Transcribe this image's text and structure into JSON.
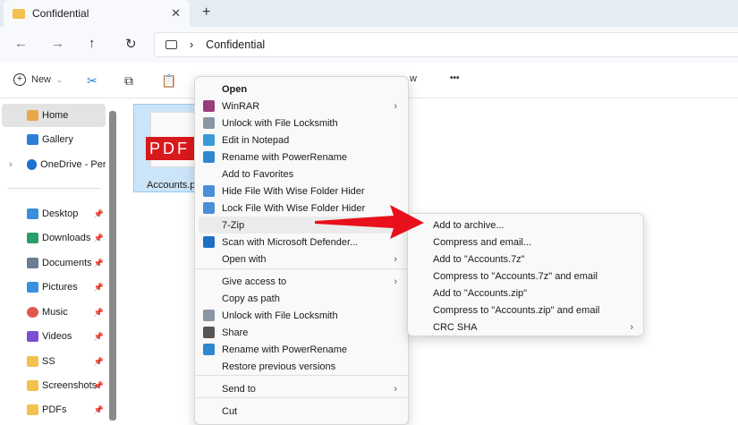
{
  "window": {
    "tab_title": "Confidential",
    "close": "✕",
    "new_tab": "+"
  },
  "address": {
    "path": "Confidential",
    "sep": "›",
    "back": "←",
    "forward": "→",
    "up": "↑",
    "refresh": "↻"
  },
  "toolbar": {
    "new_label": "New",
    "view_partial": "w",
    "more": "•••"
  },
  "sidebar": {
    "items": [
      {
        "label": "Home",
        "color": "#e8a64a"
      },
      {
        "label": "Gallery",
        "color": "#2b7fd6"
      },
      {
        "label": "OneDrive - Perso",
        "color": "#1a73d1"
      },
      {
        "label": "Desktop",
        "color": "#3b8fd8"
      },
      {
        "label": "Downloads",
        "color": "#2a9d6a"
      },
      {
        "label": "Documents",
        "color": "#6b7c93"
      },
      {
        "label": "Pictures",
        "color": "#3a8fe0"
      },
      {
        "label": "Music",
        "color": "#e2574c"
      },
      {
        "label": "Videos",
        "color": "#7a4fd6"
      },
      {
        "label": "SS",
        "color": "#f2c14e"
      },
      {
        "label": "Screenshots",
        "color": "#f2c14e"
      },
      {
        "label": "PDFs",
        "color": "#f2c14e"
      }
    ]
  },
  "file": {
    "name": "Accounts.pdf",
    "name_visible": "Accounts.p",
    "badge": "PDF"
  },
  "context_menu": {
    "items": [
      {
        "label": "Open",
        "bold": true
      },
      {
        "label": "WinRAR",
        "sub": true,
        "icon": "#9b3b7a"
      },
      {
        "label": "Unlock with File Locksmith",
        "icon": "#8a96a3"
      },
      {
        "label": "Edit in Notepad",
        "icon": "#3a9ad9"
      },
      {
        "label": "Rename with PowerRename",
        "icon": "#2f86d1"
      },
      {
        "label": "Add to Favorites"
      },
      {
        "label": "Hide File With Wise Folder Hider",
        "icon": "#4a8fd6"
      },
      {
        "label": "Lock File With Wise Folder Hider",
        "icon": "#4a8fd6"
      },
      {
        "label": "7-Zip",
        "highlight": true
      },
      {
        "label": "Scan with Microsoft Defender...",
        "icon": "#1f6fc4"
      },
      {
        "label": "Open with",
        "sub": true
      },
      {
        "label": "Give access to",
        "sub": true
      },
      {
        "label": "Copy as path"
      },
      {
        "label": "Unlock with File Locksmith",
        "icon": "#8a96a3"
      },
      {
        "label": "Share",
        "icon": "#555555"
      },
      {
        "label": "Rename with PowerRename",
        "icon": "#2f86d1"
      },
      {
        "label": "Restore previous versions"
      },
      {
        "label": "Send to",
        "sub": true
      },
      {
        "label": "Cut"
      }
    ]
  },
  "submenu": {
    "items": [
      {
        "label": "Add to archive..."
      },
      {
        "label": "Compress and email..."
      },
      {
        "label": "Add to \"Accounts.7z\""
      },
      {
        "label": "Compress to \"Accounts.7z\" and email"
      },
      {
        "label": "Add to \"Accounts.zip\""
      },
      {
        "label": "Compress to \"Accounts.zip\" and email"
      },
      {
        "label": "CRC SHA",
        "sub": true
      }
    ]
  },
  "chevron": "›",
  "accent": "#e8101a"
}
